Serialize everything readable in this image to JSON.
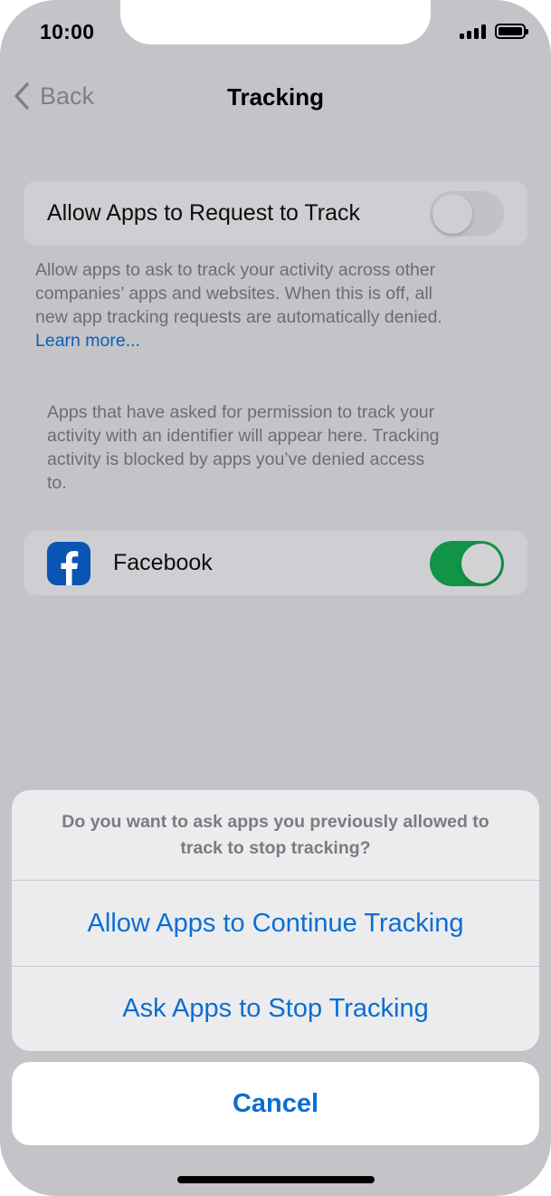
{
  "status_bar": {
    "time": "10:00"
  },
  "nav": {
    "back_label": "Back",
    "title": "Tracking"
  },
  "allow_request": {
    "label": "Allow Apps to Request to Track",
    "enabled": false
  },
  "allow_request_footnote": {
    "line1": "Allow apps to ask to track your activity across other",
    "line2": "companies’ apps and websites. When this is off, all",
    "line3": "new app tracking requests are automatically denied.",
    "link": "Learn more..."
  },
  "apps_footnote": {
    "line1": "Apps that have asked for permission to track your",
    "line2": "activity with an identifier will appear here. Tracking",
    "line3": "activity is blocked by apps you’ve denied access",
    "line4": "to."
  },
  "apps": [
    {
      "name": "Facebook",
      "icon": "facebook-icon",
      "tracking_allowed": true
    }
  ],
  "action_sheet": {
    "message_line1": "Do you want to ask apps you previously allowed to",
    "message_line2": "track to stop tracking?",
    "allow_label": "Allow Apps to Continue Tracking",
    "stop_label": "Ask Apps to Stop Tracking",
    "cancel_label": "Cancel"
  },
  "colors": {
    "accent": "#0a6fd1",
    "toggle_on": "#119447",
    "dimmed_background": "#c3c3c8",
    "facebook_blue": "#0a55b4"
  }
}
